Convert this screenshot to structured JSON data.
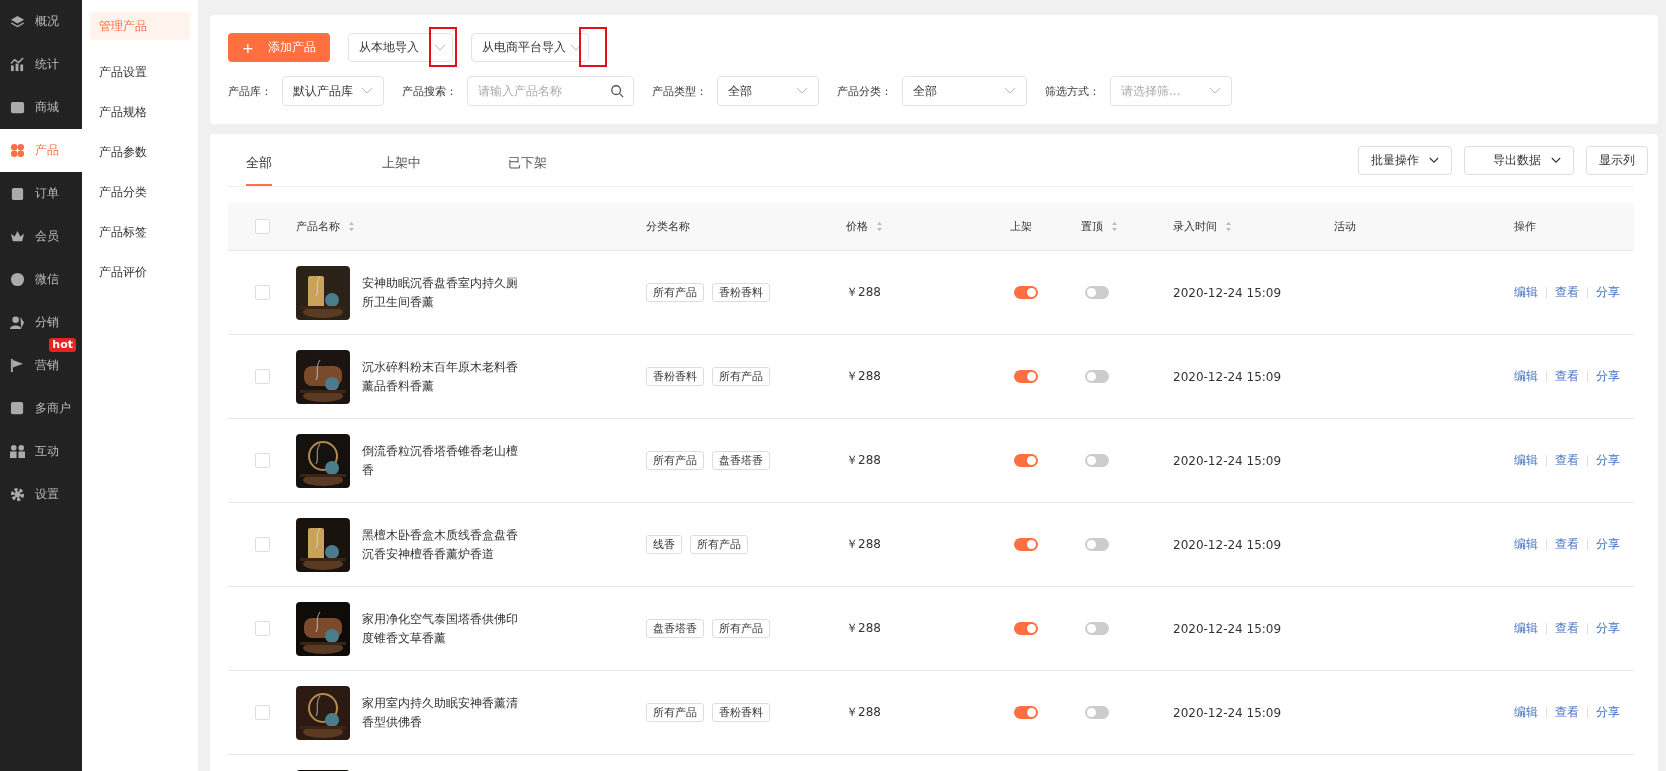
{
  "sidebar": {
    "items": [
      {
        "label": "概况",
        "selected": false
      },
      {
        "label": "统计",
        "selected": false
      },
      {
        "label": "商城",
        "selected": false
      },
      {
        "label": "产品",
        "selected": true
      },
      {
        "label": "订单",
        "selected": false
      },
      {
        "label": "会员",
        "selected": false
      },
      {
        "label": "微信",
        "selected": false
      },
      {
        "label": "分销",
        "selected": false
      },
      {
        "label": "营销",
        "selected": false,
        "badge": "hot"
      },
      {
        "label": "多商户",
        "selected": false
      },
      {
        "label": "互动",
        "selected": false
      },
      {
        "label": "设置",
        "selected": false
      }
    ]
  },
  "submenu": {
    "items": [
      {
        "label": "管理产品",
        "selected": true
      },
      {
        "label": "产品设置",
        "selected": false
      },
      {
        "label": "产品规格",
        "selected": false
      },
      {
        "label": "产品参数",
        "selected": false
      },
      {
        "label": "产品分类",
        "selected": false
      },
      {
        "label": "产品标签",
        "selected": false
      },
      {
        "label": "产品评价",
        "selected": false
      }
    ]
  },
  "toolbar": {
    "add_button": "添加产品",
    "add_icon": "+",
    "imports": [
      {
        "label": "从本地导入",
        "highlighted": true
      },
      {
        "label": "从电商平台导入",
        "highlighted": true
      }
    ]
  },
  "filters": [
    {
      "kind": "select",
      "label": "产品库：",
      "value": "默认产品库"
    },
    {
      "kind": "search",
      "label": "产品搜索：",
      "placeholder": "请输入产品名称"
    },
    {
      "kind": "select",
      "label": "产品类型：",
      "value": "全部"
    },
    {
      "kind": "select",
      "label": "产品分类：",
      "value": "全部"
    },
    {
      "kind": "select",
      "label": "筛选方式：",
      "placeholder": "请选择筛..."
    }
  ],
  "tabs": [
    {
      "label": "全部",
      "selected": true
    },
    {
      "label": "上架中",
      "selected": false
    },
    {
      "label": "已下架",
      "selected": false
    }
  ],
  "actions": [
    {
      "label": "批量操作",
      "dropdown": true
    },
    {
      "label": "导出数据",
      "dropdown": true
    },
    {
      "label": "显示列",
      "dropdown": false
    }
  ],
  "table": {
    "all_checked": false,
    "columns": [
      {
        "label": "产品名称",
        "sortable": true
      },
      {
        "label": "分类名称",
        "sortable": false
      },
      {
        "label": "价格",
        "sortable": true
      },
      {
        "label": "上架",
        "sortable": false
      },
      {
        "label": "置顶",
        "sortable": true
      },
      {
        "label": "录入时间",
        "sortable": true
      },
      {
        "label": "活动",
        "sortable": false
      },
      {
        "label": "操作",
        "sortable": false
      }
    ],
    "rows": [
      {
        "checked": false,
        "name": "安神助眠沉香盘香室内持久厕所卫生间香薰",
        "tags": [
          "所有产品",
          "香粉香料"
        ],
        "price": "￥288",
        "on_shelf": true,
        "pinned": false,
        "time": "2020-12-24 15:09",
        "links": [
          "编辑",
          "查看",
          "分享"
        ]
      },
      {
        "checked": false,
        "name": "沉水碎料粉末百年原木老料香薰品香料香薰",
        "tags": [
          "香粉香料",
          "所有产品"
        ],
        "price": "￥288",
        "on_shelf": true,
        "pinned": false,
        "time": "2020-12-24 15:09",
        "links": [
          "编辑",
          "查看",
          "分享"
        ]
      },
      {
        "checked": false,
        "name": "倒流香粒沉香塔香锥香老山檀香",
        "tags": [
          "所有产品",
          "盘香塔香"
        ],
        "price": "￥288",
        "on_shelf": true,
        "pinned": false,
        "time": "2020-12-24 15:09",
        "links": [
          "编辑",
          "查看",
          "分享"
        ]
      },
      {
        "checked": false,
        "name": "黑檀木卧香盒木质线香盒盘香沉香安神檀香香薰炉香道",
        "tags": [
          "线香",
          "所有产品"
        ],
        "price": "￥288",
        "on_shelf": true,
        "pinned": false,
        "time": "2020-12-24 15:09",
        "links": [
          "编辑",
          "查看",
          "分享"
        ]
      },
      {
        "checked": false,
        "name": "家用净化空气泰国塔香供佛印度锥香文草香薰",
        "tags": [
          "盘香塔香",
          "所有产品"
        ],
        "price": "￥288",
        "on_shelf": true,
        "pinned": false,
        "time": "2020-12-24 15:09",
        "links": [
          "编辑",
          "查看",
          "分享"
        ]
      },
      {
        "checked": false,
        "name": "家用室内持久助眠安神香薰清香型供佛香",
        "tags": [
          "所有产品",
          "香粉香料"
        ],
        "price": "￥288",
        "on_shelf": true,
        "pinned": false,
        "time": "2020-12-24 15:09",
        "links": [
          "编辑",
          "查看",
          "分享"
        ]
      }
    ]
  }
}
